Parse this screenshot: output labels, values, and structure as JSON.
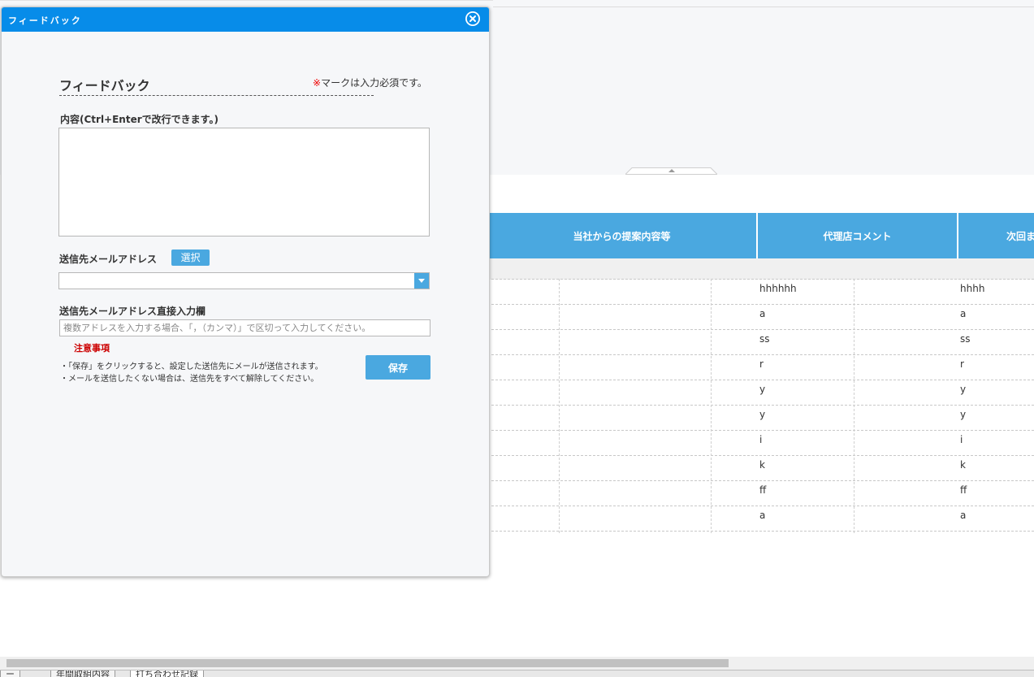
{
  "dialog": {
    "title": "フィードバック",
    "form_title": "フィードバック",
    "required_mark": "※",
    "required_text": "マークは入力必須です。",
    "content_label": "内容(Ctrl+Enterで改行できます。)",
    "content_value": "",
    "recipient_label": "送信先メールアドレス",
    "select_button": "選択",
    "recipient_selected": "",
    "direct_label": "送信先メールアドレス直接入力欄",
    "direct_placeholder": "複数アドレスを入力する場合、「，（カンマ）」で区切って入力してください。",
    "notice_title": "注意事項",
    "notice_1": "・「保存」をクリックすると、設定した送信先にメールが送信されます。",
    "notice_2": "・メールを送信したくない場合は、送信先をすべて解除してください。",
    "save_button": "保存"
  },
  "grid": {
    "headers": [
      "当社からの提案内容等",
      "代理店コメント",
      "次回ま"
    ],
    "rows": [
      {
        "agency_comment": "hhhhhh",
        "next": "hhhh"
      },
      {
        "agency_comment": "a",
        "next": "a"
      },
      {
        "agency_comment": "ss",
        "next": "ss"
      },
      {
        "agency_comment": "r",
        "next": "r"
      },
      {
        "agency_comment": "y",
        "next": "y"
      },
      {
        "agency_comment": "y",
        "next": "y"
      },
      {
        "agency_comment": "i",
        "next": "i"
      },
      {
        "agency_comment": "k",
        "next": "k"
      },
      {
        "agency_comment": "ff",
        "next": "ff"
      },
      {
        "agency_comment": "a",
        "next": "a"
      }
    ]
  },
  "sheet_tabs": [
    "ー",
    "年間取組内容",
    "打ち合わせ記録"
  ],
  "colors": {
    "title_bar": "#078ce9",
    "accent": "#4aa8e0",
    "required": "#e00000",
    "notice": "#cc0000"
  }
}
